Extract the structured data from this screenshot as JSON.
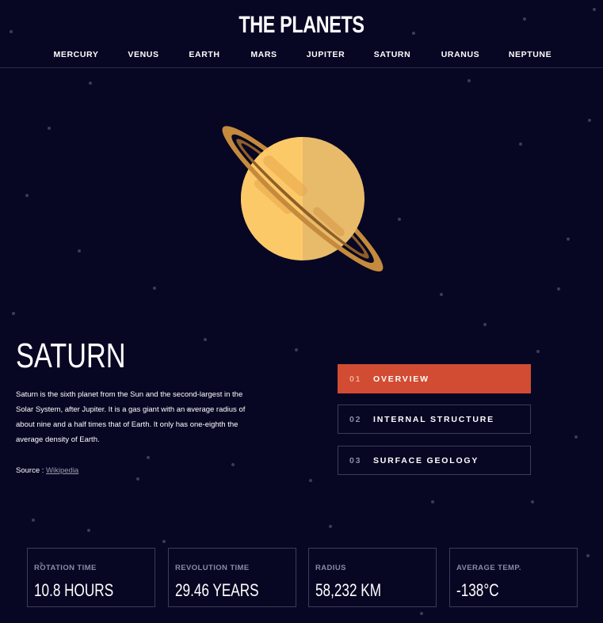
{
  "header": {
    "logo": "THE PLANETS",
    "nav": [
      "MERCURY",
      "VENUS",
      "EARTH",
      "MARS",
      "JUPITER",
      "SATURN",
      "URANUS",
      "NEPTUNE"
    ]
  },
  "planet": {
    "name": "SATURN",
    "description": "Saturn is the sixth planet from the Sun and the second-largest in the Solar System, after Jupiter. It is a gas giant with an average radius of about nine and a half times that of Earth. It only has one-eighth the average density of Earth.",
    "source_label": "Source :",
    "source_link": "Wikipedia"
  },
  "tabs": [
    {
      "num": "01",
      "label": "OVERVIEW"
    },
    {
      "num": "02",
      "label": "INTERNAL STRUCTURE"
    },
    {
      "num": "03",
      "label": "SURFACE GEOLOGY"
    }
  ],
  "stats": [
    {
      "label": "ROTATION TIME",
      "value": "10.8 HOURS"
    },
    {
      "label": "REVOLUTION TIME",
      "value": "29.46 YEARS"
    },
    {
      "label": "RADIUS",
      "value": "58,232 KM"
    },
    {
      "label": "AVERAGE TEMP.",
      "value": "-138°C"
    }
  ],
  "colors": {
    "background": "#070724",
    "accent": "#d14c32",
    "planet_light": "#fcc969",
    "planet_dark": "#e8bb6b",
    "ring": "#c58a3c"
  }
}
